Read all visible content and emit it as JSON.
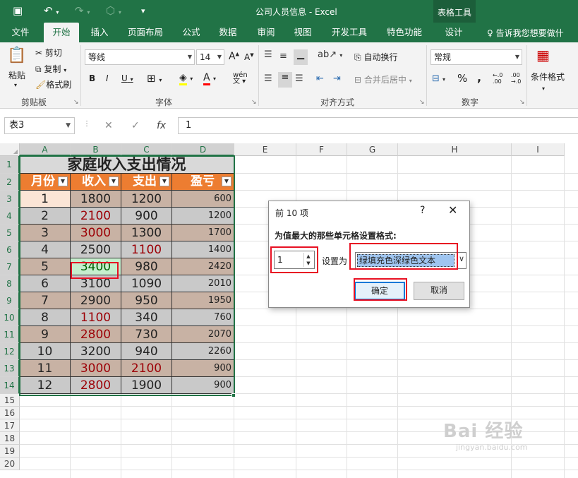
{
  "titlebar": {
    "title": "公司人员信息 - Excel",
    "context_tools": "表格工具"
  },
  "tabs": [
    "文件",
    "开始",
    "插入",
    "页面布局",
    "公式",
    "数据",
    "审阅",
    "视图",
    "开发工具",
    "特色功能",
    "设计"
  ],
  "tell_me": "告诉我您想要做什",
  "ribbon": {
    "clipboard": {
      "paste": "粘贴",
      "cut": "剪切",
      "copy": "复制",
      "format_painter": "格式刷",
      "label": "剪贴板"
    },
    "font": {
      "name": "等线",
      "size": "14",
      "label": "字体",
      "bold": "B",
      "italic": "I",
      "underline": "U",
      "grow": "A",
      "shrink": "A",
      "phonetic": "wén"
    },
    "alignment": {
      "wrap": "自动换行",
      "merge": "合并后居中",
      "label": "对齐方式"
    },
    "number": {
      "format": "常规",
      "label": "数字",
      "percent": "%",
      "comma": ",",
      "inc_decimal": ".00",
      "dec_decimal": ".00"
    },
    "styles": {
      "conditional": "条件格式"
    }
  },
  "formula_bar": {
    "name_box": "表3",
    "cancel": "✕",
    "enter": "✓",
    "fx": "fx",
    "formula": "1"
  },
  "columns": [
    "A",
    "B",
    "C",
    "D",
    "E",
    "F",
    "G",
    "H",
    "I"
  ],
  "rows": [
    "1",
    "2",
    "3",
    "4",
    "5",
    "6",
    "7",
    "8",
    "9",
    "10",
    "11",
    "12",
    "13",
    "14",
    "15",
    "16",
    "17",
    "18",
    "19",
    "20"
  ],
  "table": {
    "title": "家庭收入支出情况",
    "headers": [
      "月份",
      "收入",
      "支出",
      "盈亏"
    ],
    "data": [
      [
        "1",
        "1800",
        "1200",
        "600"
      ],
      [
        "2",
        "2100",
        "900",
        "1200"
      ],
      [
        "3",
        "3000",
        "1300",
        "1700"
      ],
      [
        "4",
        "2500",
        "1100",
        "1400"
      ],
      [
        "5",
        "3400",
        "980",
        "2420"
      ],
      [
        "6",
        "3100",
        "1090",
        "2010"
      ],
      [
        "7",
        "2900",
        "950",
        "1950"
      ],
      [
        "8",
        "1100",
        "340",
        "760"
      ],
      [
        "9",
        "2800",
        "730",
        "2070"
      ],
      [
        "10",
        "3200",
        "940",
        "2260"
      ],
      [
        "11",
        "3000",
        "2100",
        "900"
      ],
      [
        "12",
        "2800",
        "1900",
        "900"
      ]
    ]
  },
  "colors": {
    "excel_green": "#217346",
    "header_orange": "#ed7d31",
    "row_gray": "#c9c9c9",
    "row_tan": "#c8b2a4",
    "row_first_light": "#fbe5d6",
    "dark_red_text": "#9c0006",
    "highlight_green_fill": "#c6efce",
    "highlight_green_text": "#006100",
    "annotation_red": "#e81123"
  },
  "dialog": {
    "title": "前 10 项",
    "help": "?",
    "close": "✕",
    "prompt": "为值最大的那些单元格设置格式:",
    "count": "1",
    "set_to_label": "设置为",
    "format_option": "绿填充色深绿色文本",
    "ok": "确定",
    "cancel": "取消"
  },
  "watermark": {
    "brand": "Bai 经验",
    "url": "jingyan.baidu.com"
  }
}
